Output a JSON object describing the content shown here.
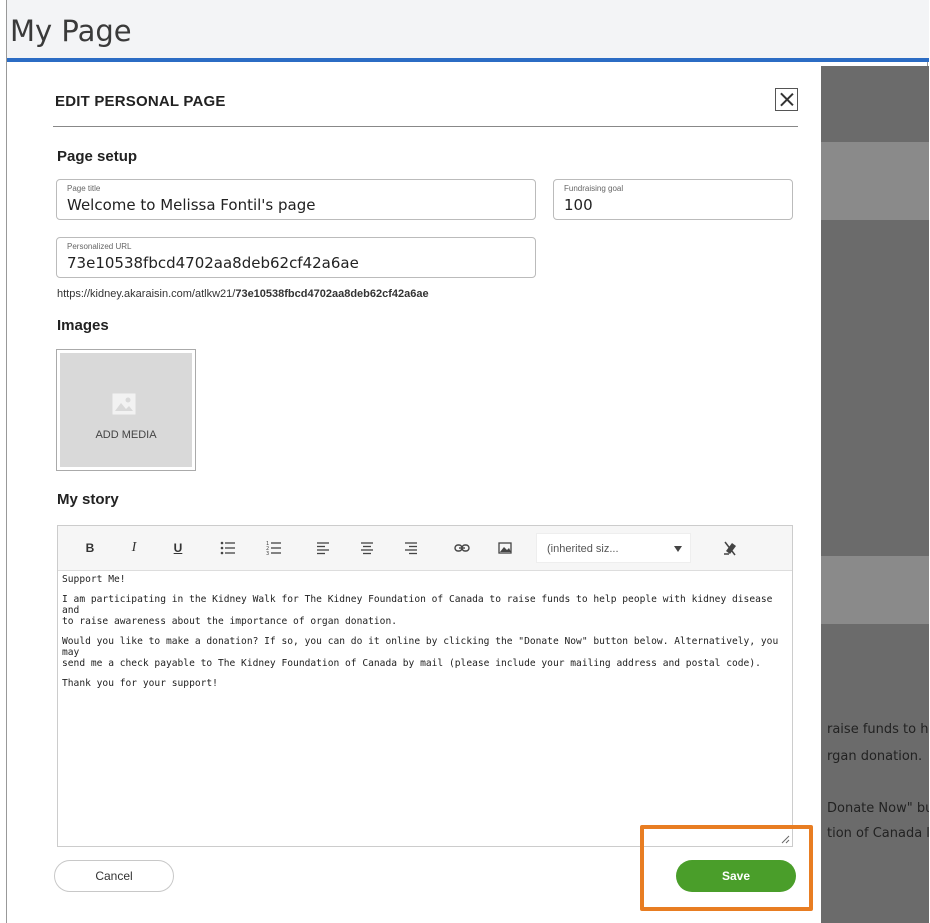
{
  "page": {
    "title": "My Page"
  },
  "background_text": [
    "raise funds to h",
    "rgan donation.",
    "Donate Now\" bu",
    "tion of Canada l"
  ],
  "modal": {
    "title": "EDIT PERSONAL PAGE",
    "page_setup": {
      "heading": "Page setup",
      "page_title": {
        "label": "Page title",
        "value": "Welcome to Melissa Fontil's page"
      },
      "fundraising_goal": {
        "label": "Fundraising goal",
        "value": "100"
      },
      "personalized_url": {
        "label": "Personalized URL",
        "value": "73e10538fbcd4702aa8deb62cf42a6ae"
      },
      "url_preview": {
        "base": "https://kidney.akaraisin.com/atlkw21/",
        "slug": "73e10538fbcd4702aa8deb62cf42a6ae"
      }
    },
    "images": {
      "heading": "Images",
      "add_media_label": "ADD MEDIA"
    },
    "story": {
      "heading": "My story",
      "toolbar": {
        "bold": "B",
        "italic": "I",
        "underline": "U",
        "font_size_select": "(inherited siz..."
      },
      "paragraphs": [
        "Support Me!",
        "I am participating in the Kidney Walk for The Kidney Foundation of Canada to raise funds to help people with kidney disease and\nto raise awareness about the importance of organ donation.",
        "Would you like to make a donation? If so, you can do it online by clicking the \"Donate Now\" button below. Alternatively, you may\nsend me a check payable to The Kidney Foundation of Canada by mail (please include your mailing address and postal code).",
        "Thank you for your support!"
      ]
    },
    "actions": {
      "cancel": "Cancel",
      "save": "Save"
    }
  },
  "colors": {
    "accent": "#2b6cc4",
    "save": "#4a9e2a",
    "highlight": "#e87d22"
  },
  "icons": [
    "close-icon",
    "image-placeholder-icon",
    "bullet-list-icon",
    "numbered-list-icon",
    "align-left-icon",
    "align-center-icon",
    "align-right-icon",
    "link-icon",
    "image-icon",
    "clear-format-icon",
    "resize-grip-icon"
  ]
}
